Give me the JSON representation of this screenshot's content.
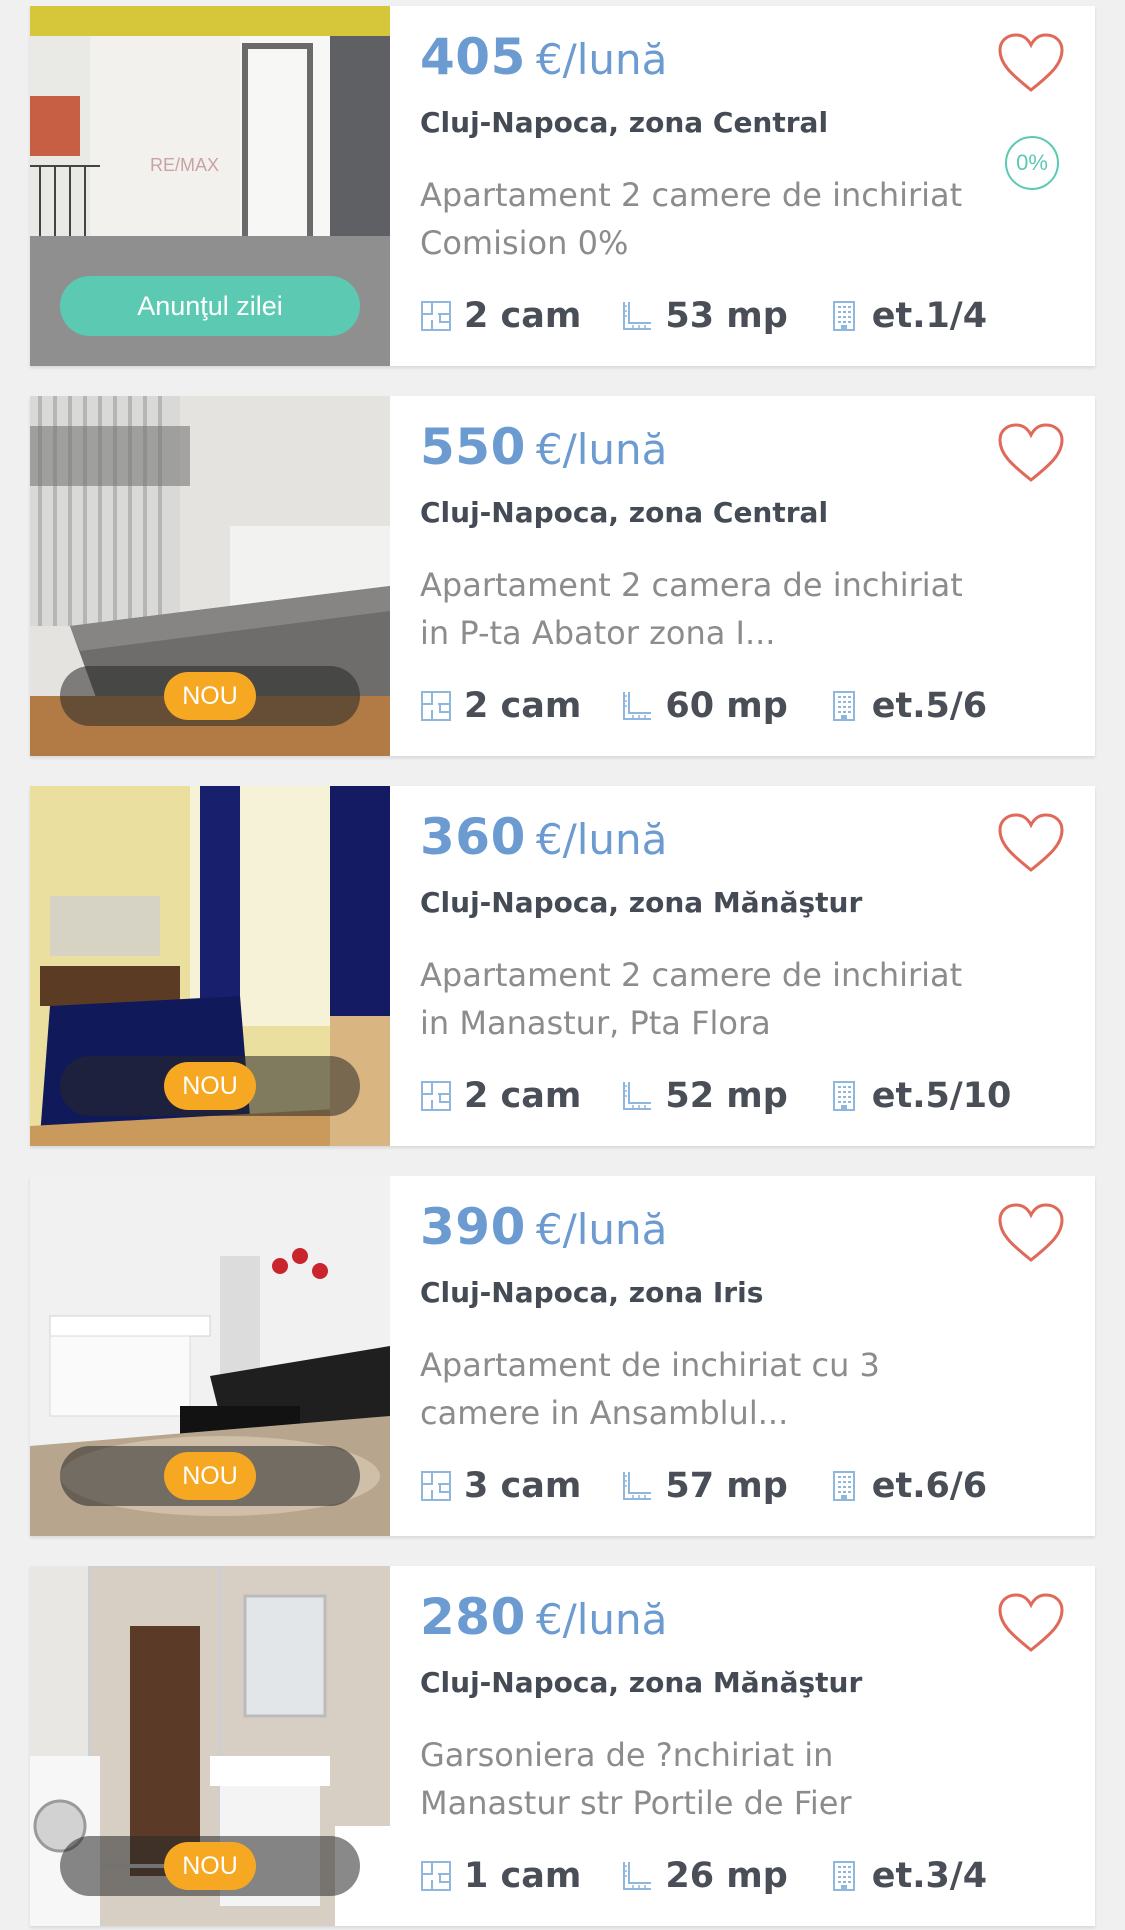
{
  "colors": {
    "price": "#6b9bd0",
    "heart": "#e06a5a",
    "badge_day": "#5ccab2",
    "badge_new": "#f7a823"
  },
  "listings": [
    {
      "price": "405",
      "unit": "€/lună",
      "location": "Cluj-Napoca, zona Central",
      "description": "Apartament 2 camere de inchiriat Comision 0%",
      "rooms": "2 cam",
      "area": "53 mp",
      "floor": "et.1/4",
      "badge": "Anunţul zilei",
      "zero_commission": "0%",
      "watermark": "RE/MAX"
    },
    {
      "price": "550",
      "unit": "€/lună",
      "location": "Cluj-Napoca, zona Central",
      "description": "Apartament 2 camera de inchiriat in P-ta Abator zona I...",
      "rooms": "2 cam",
      "area": "60 mp",
      "floor": "et.5/6",
      "badge": "NOU"
    },
    {
      "price": "360",
      "unit": "€/lună",
      "location": "Cluj-Napoca, zona Mănăştur",
      "description": "Apartament 2 camere de inchiriat in Manastur, Pta Flora",
      "rooms": "2 cam",
      "area": "52 mp",
      "floor": "et.5/10",
      "badge": "NOU"
    },
    {
      "price": "390",
      "unit": "€/lună",
      "location": "Cluj-Napoca, zona Iris",
      "description": "Apartament de inchiriat cu 3 camere in Ansamblul...",
      "rooms": "3 cam",
      "area": "57 mp",
      "floor": "et.6/6",
      "badge": "NOU"
    },
    {
      "price": "280",
      "unit": "€/lună",
      "location": "Cluj-Napoca, zona Mănăştur",
      "description": "Garsoniera de ?nchiriat in Manastur str Portile de Fier",
      "rooms": "1 cam",
      "area": "26 mp",
      "floor": "et.3/4",
      "badge": "NOU"
    }
  ]
}
